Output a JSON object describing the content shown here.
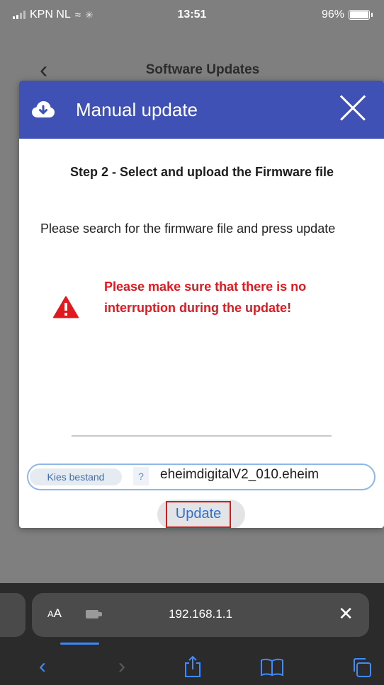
{
  "status_bar": {
    "carrier": "KPN NL",
    "time": "13:51",
    "battery": "96%"
  },
  "page": {
    "title": "Software Updates"
  },
  "modal": {
    "title": "Manual update",
    "step_title": "Step 2 - Select and upload the Firmware file",
    "description": "Please search for the firmware file and press update",
    "warning": "Please make sure that there is no interruption during the update!",
    "file_input": {
      "choose_label": "Kies bestand",
      "help": "?",
      "file_name": "eheimdigitalV2_010.eheim"
    },
    "update_label": "Update"
  },
  "browser": {
    "aa_label": "AA",
    "url": "192.168.1.1",
    "clear_label": "✕"
  },
  "colors": {
    "modal_header": "#3f51b5",
    "warning": "#e3181f",
    "link_blue": "#2f6fd1",
    "highlight_box": "#d41b1b"
  }
}
